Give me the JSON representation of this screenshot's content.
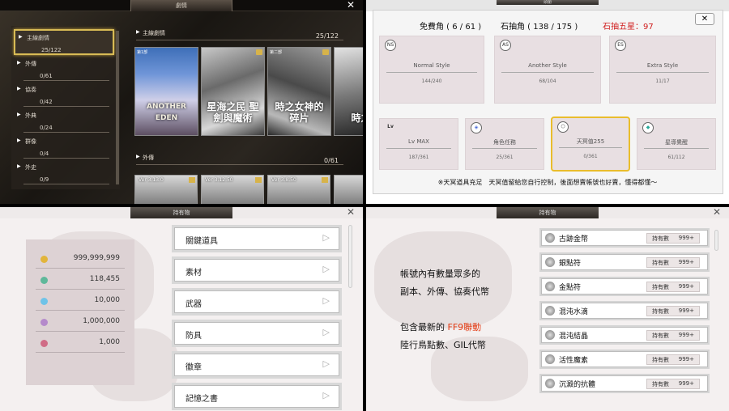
{
  "story": {
    "tab_title": "劇情",
    "close": "✕",
    "sidebar": [
      {
        "label": "主線劇情",
        "count": "25/122",
        "active": true
      },
      {
        "label": "外傳",
        "count": "0/61"
      },
      {
        "label": "協奏",
        "count": "0/42"
      },
      {
        "label": "外典",
        "count": "0/24"
      },
      {
        "label": "群像",
        "count": "0/4"
      },
      {
        "label": "外史",
        "count": "0/9"
      }
    ],
    "main_section": {
      "title": "主線劇情",
      "count": "25/122"
    },
    "side_section": {
      "title": "外傳",
      "count": "0/61"
    },
    "cards": [
      {
        "badge": "第1部",
        "logo": "ANOTHER EDEN"
      },
      {
        "badge": "",
        "logo": "星海之民 聖劍與魔術"
      },
      {
        "badge": "第二部",
        "logo": "時之女神的碎片"
      },
      {
        "badge": "",
        "logo": "時之女"
      }
    ],
    "gaiden_cards": [
      "Ver 3.13.0",
      "Ver 3.12.50",
      "Ver 3.8.50",
      ""
    ]
  },
  "stats": {
    "tab_title": "頭銜",
    "close": "✕",
    "free_gems": "免費角 ( 6 / 61 )",
    "paid_gems": "石抽角 ( 138 / 175 )",
    "five_star": "石抽五星：97",
    "tiles_row1": [
      {
        "icon": "NS",
        "name": "Normal Style",
        "value": "144/240"
      },
      {
        "icon": "AS",
        "name": "Another Style",
        "value": "68/104"
      },
      {
        "icon": "ES",
        "name": "Extra Style",
        "value": "11/17"
      }
    ],
    "tiles_row2": [
      {
        "icon": "Lv",
        "name": "Lv MAX",
        "value": "187/361"
      },
      {
        "icon": "◈",
        "name": "角色任務",
        "value": "25/361"
      },
      {
        "icon": "⬡",
        "name": "天冥值255",
        "value": "0/361",
        "selected": true
      },
      {
        "icon": "◆",
        "name": "星導覺醒",
        "value": "61/112"
      }
    ],
    "note": "※天冥道具充足　天冥值留給您自行控制，後面想賣帳號也好賣，懂得都懂～"
  },
  "inventory": {
    "tab_title": "持有物",
    "close": "✕",
    "currencies": [
      {
        "amount": "999,999,999",
        "color": "#e2b53b"
      },
      {
        "amount": "118,455",
        "color": "#5fb89a"
      },
      {
        "amount": "10,000",
        "color": "#6fc3e8"
      },
      {
        "amount": "1,000,000",
        "color": "#b58acb"
      },
      {
        "amount": "1,000",
        "color": "#d06c86"
      }
    ],
    "categories": [
      "關鍵道具",
      "素材",
      "武器",
      "防具",
      "徽章",
      "記憶之書"
    ]
  },
  "items": {
    "tab_title": "持有物",
    "close": "✕",
    "promo_line1": "帳號內有數量眾多的",
    "promo_line2": "副本、外傳、協奏代幣",
    "promo_line3a": "包含最新的",
    "promo_line3b": "FF9聯動",
    "promo_line4": "陸行鳥點數、GIL代幣",
    "hold_label": "持有數",
    "hold_value": "999+",
    "list": [
      "古跡金幣",
      "銀點符",
      "金點符",
      "混沌水滴",
      "混沌結晶",
      "活性魔素",
      "沉澱的抗體"
    ]
  }
}
